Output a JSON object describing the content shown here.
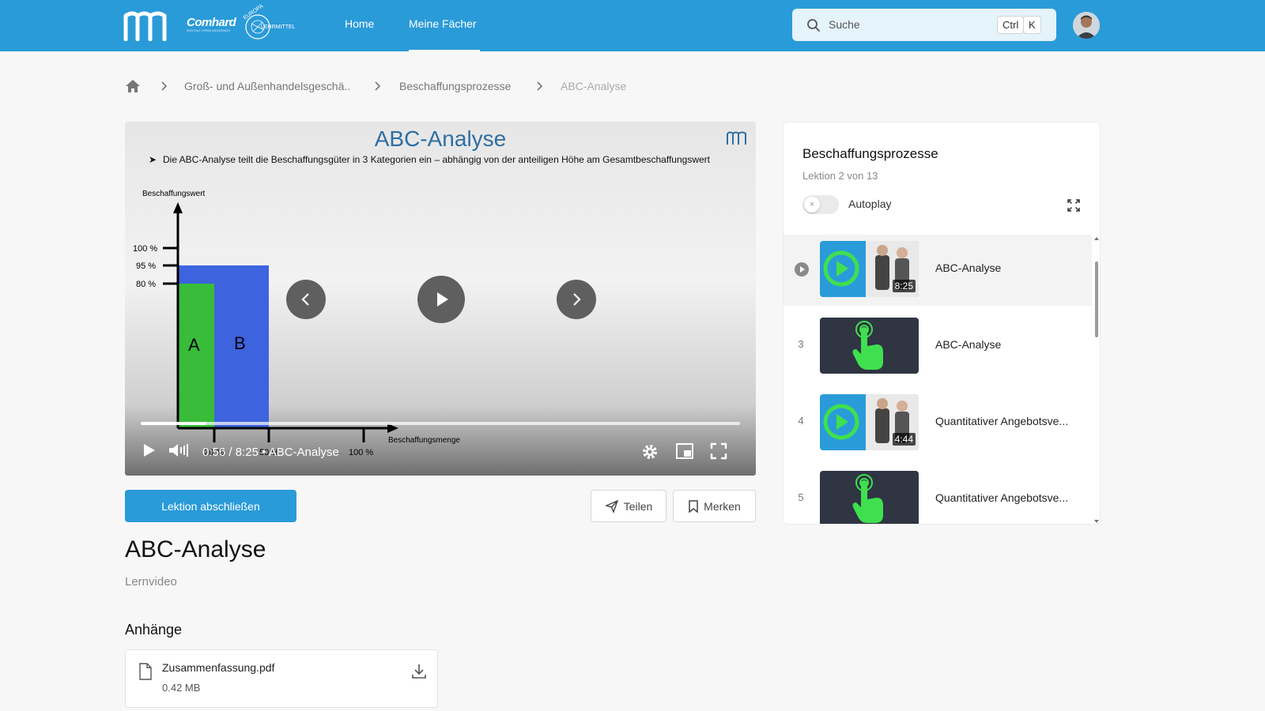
{
  "header": {
    "logo_name": "Comhard",
    "logo_tagline": "DIGITALE VERBUNDLERNEN",
    "publisher_top": "EUROPA",
    "publisher_bottom": "LEHRMITTEL",
    "nav": [
      {
        "label": "Home",
        "active": false
      },
      {
        "label": "Meine Fächer",
        "active": true
      }
    ],
    "search_placeholder": "Suche",
    "shortcut_keys": [
      "Ctrl",
      "K"
    ],
    "brand_color": "#2a9bd9"
  },
  "breadcrumb": {
    "items": [
      "Groß- und Außenhandelsgeschä..",
      "Beschaffungsprozesse",
      "ABC-Analyse"
    ]
  },
  "video": {
    "slide_title": "ABC-Analyse",
    "slide_text": "Die ABC-Analyse teilt die Beschaffungsgüter in 3 Kategorien ein – abhängig von der anteiligen Höhe am Gesamtbeschaffungswert",
    "chart": {
      "ylabel": "Beschaffungswert",
      "xlabel": "Beschaffungsmenge",
      "y_ticks": [
        "100 %",
        "95 %",
        "80 %"
      ],
      "x_ticks": [
        "20 %",
        "50 %",
        "100 %"
      ],
      "bar_a_label": "A",
      "bar_b_label": "B"
    },
    "current_time": "0:56",
    "duration": "8:25",
    "chapter": "ABC-Analyse",
    "progress": 0.11
  },
  "actions": {
    "complete": "Lektion abschließen",
    "share": "Teilen",
    "bookmark": "Merken"
  },
  "lesson": {
    "title": "ABC-Analyse",
    "type": "Lernvideo"
  },
  "attachments": {
    "heading": "Anhänge",
    "files": [
      {
        "name": "Zusammenfassung.pdf",
        "size": "0.42 MB"
      }
    ]
  },
  "sidebar": {
    "title": "Beschaffungsprozesse",
    "subtitle": "Lektion 2 von 13",
    "autoplay_label": "Autoplay",
    "autoplay": false,
    "items": [
      {
        "num": "",
        "label": "ABC-Analyse",
        "duration": "8:25",
        "kind": "video",
        "active": true
      },
      {
        "num": "3",
        "label": "ABC-Analyse",
        "duration": "",
        "kind": "interactive",
        "active": false
      },
      {
        "num": "4",
        "label": "Quantitativer Angebotsve...",
        "duration": "4:44",
        "kind": "video",
        "active": false
      },
      {
        "num": "5",
        "label": "Quantitativer Angebotsve...",
        "duration": "",
        "kind": "interactive",
        "active": false
      }
    ]
  }
}
